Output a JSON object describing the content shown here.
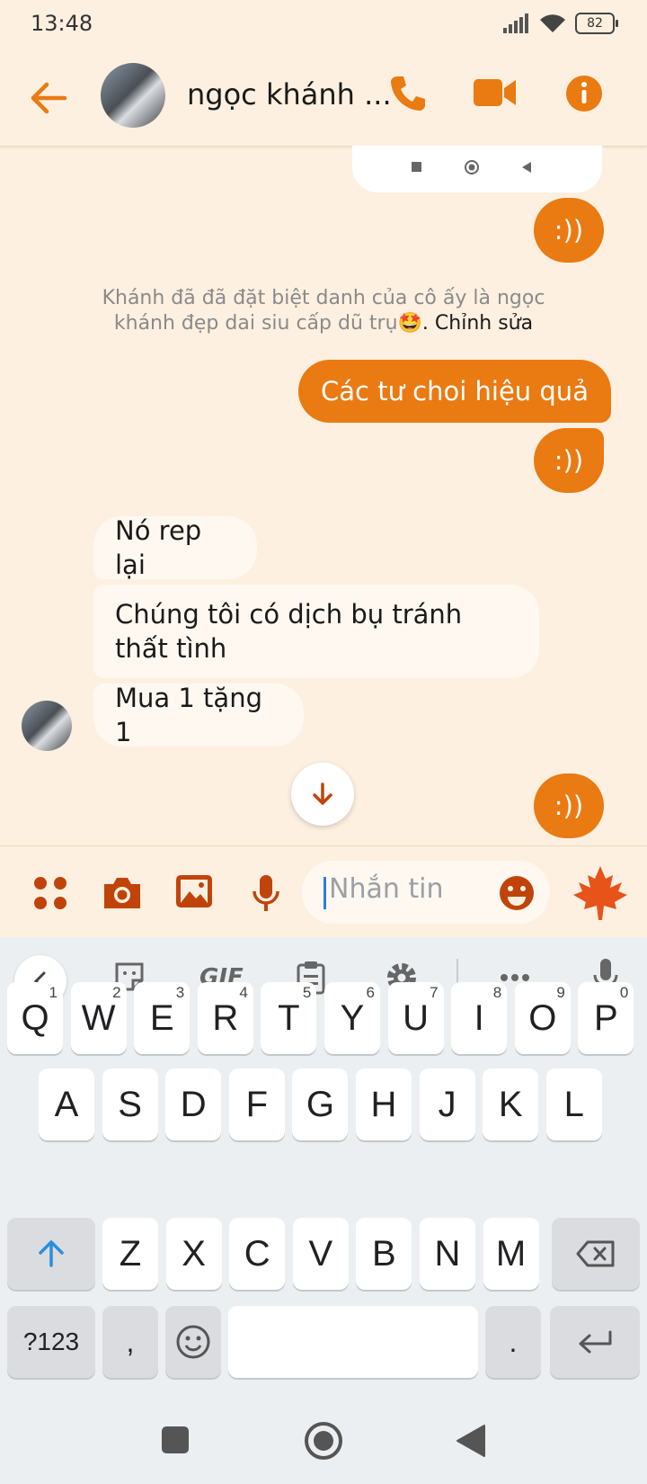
{
  "status_bar": {
    "time": "13:48",
    "battery": "82"
  },
  "header": {
    "contact_name": "ngọc khánh ..."
  },
  "messages": {
    "out_emoticon_1": ":))",
    "nickname_note": "Khánh đã đã đặt biệt danh của cô ấy là ngọc khánh đẹp dai siu cấp dũ trụ",
    "nickname_emoji": "🤩",
    "edit_link": ". Chỉnh sửa",
    "out_text_1": "Các tư choi hiệu quả",
    "out_emoticon_2": ":))",
    "in_1": "Nó rep lại",
    "in_2": "Chúng tôi có dịch bụ tránh thất tình",
    "in_3": "Mua 1 tặng 1",
    "out_emoticon_3": ":))"
  },
  "composer": {
    "placeholder": "Nhắn tin"
  },
  "keyboard": {
    "toolbar": {
      "gif": "GIF"
    },
    "row1": [
      {
        "k": "Q",
        "n": "1"
      },
      {
        "k": "W",
        "n": "2"
      },
      {
        "k": "E",
        "n": "3"
      },
      {
        "k": "R",
        "n": "4"
      },
      {
        "k": "T",
        "n": "5"
      },
      {
        "k": "Y",
        "n": "6"
      },
      {
        "k": "U",
        "n": "7"
      },
      {
        "k": "I",
        "n": "8"
      },
      {
        "k": "O",
        "n": "9"
      },
      {
        "k": "P",
        "n": "0"
      }
    ],
    "row2": [
      "A",
      "S",
      "D",
      "F",
      "G",
      "H",
      "J",
      "K",
      "L"
    ],
    "row3": [
      "Z",
      "X",
      "C",
      "V",
      "B",
      "N",
      "M"
    ],
    "symbols": "?123",
    "comma": ",",
    "period": "."
  },
  "colors": {
    "accent": "#ea7a12",
    "icon": "#c0440a",
    "background": "#fdf0e0"
  }
}
